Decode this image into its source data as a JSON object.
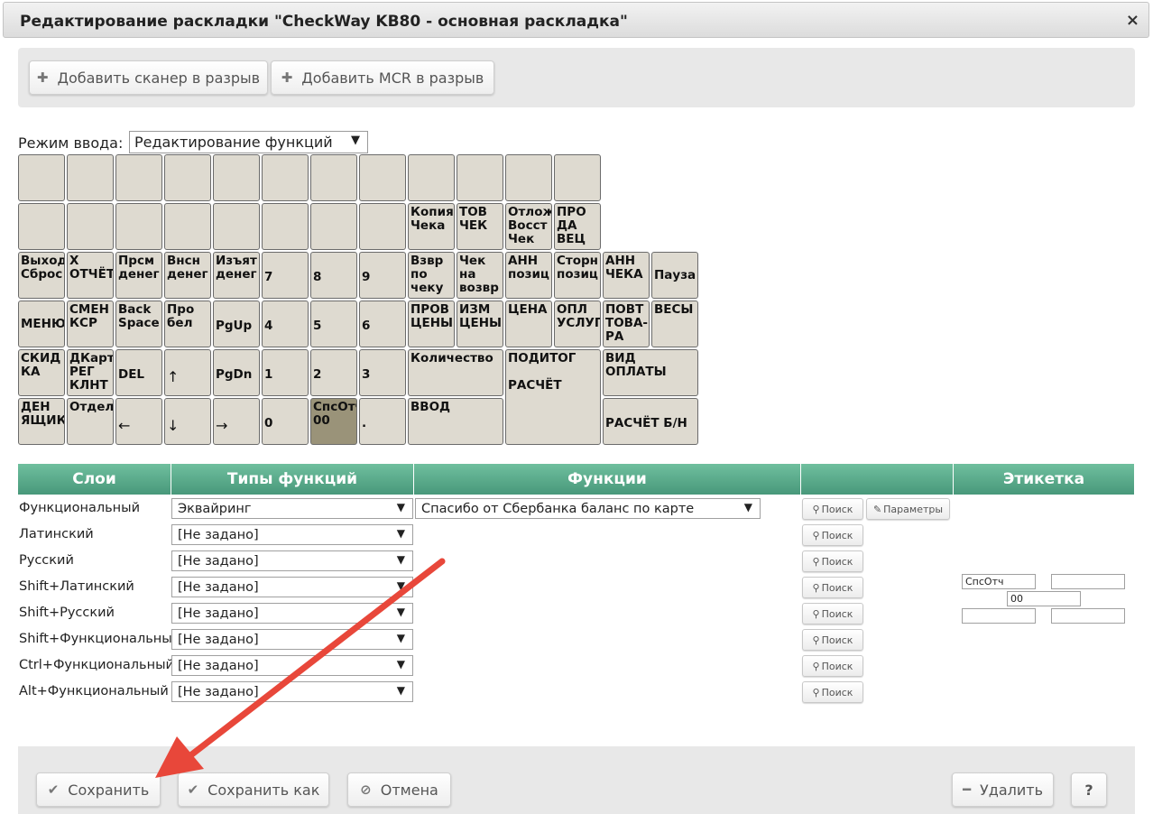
{
  "dialog": {
    "title": "Редактирование раскладки \"CheckWay KB80 - основная раскладка\"",
    "close_icon": "×"
  },
  "toolbar": {
    "add_scanner_label": "Добавить сканер в разрыв",
    "add_mcr_label": "Добавить MCR в разрыв",
    "plus_icon": "✚"
  },
  "mode": {
    "label": "Режим ввода:",
    "value": "Редактирование функций",
    "arrow": "▼"
  },
  "keys": {
    "k1": "Копия\nЧека",
    "k2": "ТОВ\nЧЕК",
    "k3": "Отлож\nВосст\nЧек",
    "k4": "ПРО\nДА\nВЕЦ",
    "k5": "Выход\nСброс",
    "k6": "Х\nОТЧЁТ",
    "k7": "Прсм\nденег",
    "k8": "Внсн\nденег",
    "k9": "Изъят\nденег",
    "k10": "7",
    "k11": "8",
    "k12": "9",
    "k13": "Взвр\nпо\nчеку",
    "k14": "Чек\nна\nвозвр",
    "k15": "АНН\nпозиц",
    "k16": "Сторн\nпозиц",
    "k17": "АНН\nЧЕКА",
    "k18": "Пауза",
    "k19": "МЕНЮ",
    "k20": "СМЕН\nКСР",
    "k21": "Back\nSpace",
    "k22": "Про\nбел",
    "k23": "PgUp",
    "k24": "4",
    "k25": "5",
    "k26": "6",
    "k27": "ПРОВ\nЦЕНЫ",
    "k28": "ИЗМ\nЦЕНЫ",
    "k29": "ЦЕНА",
    "k30": "ОПЛ\nУСЛУГ",
    "k31": "ПОВТ\nТОВА-\nРА",
    "k32": "ВЕСЫ",
    "k33": "СКИД\nКА",
    "k34": "ДКарт\nРЕГ\nКЛНТ",
    "k35": "DEL",
    "k36": "↑",
    "k37": "PgDn",
    "k38": "1",
    "k39": "2",
    "k40": "3",
    "k41": "Количество",
    "k42": "ПОДИТОГ\n\nРАСЧЁТ",
    "k43": "ВИД\nОПЛАТЫ",
    "k44": "ДЕН\nЯЩИК",
    "k45": "Отдел",
    "k46": "←",
    "k47": "↓",
    "k48": "→",
    "k49": "0",
    "k50": "СпсОтч\n00",
    "k51": ".",
    "k52": "ВВОД",
    "k53": "РАСЧЁТ Б/Н"
  },
  "table": {
    "headers": [
      "Слои",
      "Типы функций",
      "Функции",
      "",
      "Этикетка"
    ],
    "rows": [
      {
        "layer": "Функциональный",
        "type": "Эквайринг",
        "function": "Спасибо от Сбербанка баланс по карте"
      },
      {
        "layer": "Латинский",
        "type": "[Не задано]"
      },
      {
        "layer": "Русский",
        "type": "[Не задано]"
      },
      {
        "layer": "Shift+Латинский",
        "type": "[Не задано]"
      },
      {
        "layer": "Shift+Русский",
        "type": "[Не задано]"
      },
      {
        "layer": "Shift+Функциональный",
        "type": "[Не задано]"
      },
      {
        "layer": "Ctrl+Функциональный",
        "type": "[Не задано]"
      },
      {
        "layer": "Alt+Функциональный",
        "type": "[Не задано]"
      }
    ],
    "search_label": "Поиск",
    "params_label": "Параметры",
    "search_icon": "⚲",
    "params_icon": "✎"
  },
  "label_fields": {
    "top_left": "СпсОтч",
    "top_right": "",
    "middle": "00",
    "bottom_left": "",
    "bottom_right": ""
  },
  "footer": {
    "save_label": "Сохранить",
    "save_as_label": "Сохранить как",
    "cancel_label": "Отмена",
    "delete_label": "Удалить",
    "help_label": "?",
    "check_icon": "✔",
    "save_as_icon": "✔",
    "cancel_icon": "⊘",
    "minus_icon": "━"
  },
  "colors": {
    "header_green": "#5aab8b",
    "key_bg": "#dedad0",
    "key_selected": "#9a9379",
    "annotation_arrow": "#e8473a"
  }
}
